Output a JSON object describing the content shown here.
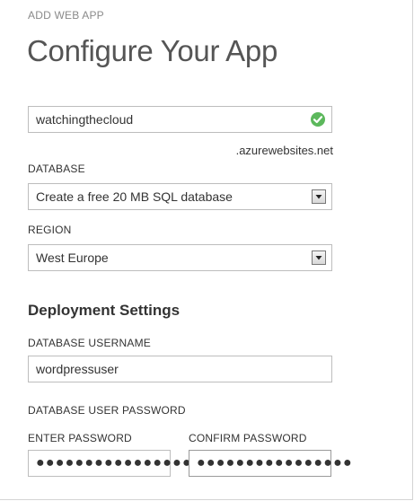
{
  "wizard": {
    "step_label": "ADD WEB APP",
    "title": "Configure Your App"
  },
  "url": {
    "value": "watchingthecloud",
    "suffix": ".azurewebsites.net",
    "valid_icon": "check-circle-icon",
    "valid_color": "#5cb85c"
  },
  "database": {
    "label": "DATABASE",
    "selected": "Create a free 20 MB SQL database"
  },
  "region": {
    "label": "REGION",
    "selected": "West Europe"
  },
  "deployment": {
    "heading": "Deployment Settings",
    "username_label": "DATABASE USERNAME",
    "username_value": "wordpressuser",
    "password_section_label": "DATABASE USER PASSWORD",
    "enter_password_label": "ENTER PASSWORD",
    "enter_password_value": "●●●●●●●●●●●●●●●●",
    "confirm_password_label": "CONFIRM PASSWORD",
    "confirm_password_value": "●●●●●●●●●●●●●●●●"
  }
}
